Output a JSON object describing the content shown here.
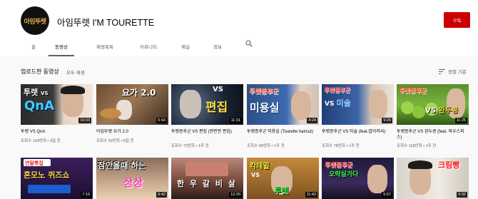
{
  "channel": {
    "avatar_text": "아임뚜렛",
    "title": "아임뚜렛 I'M TOURETTE",
    "subscribe_label": "구독"
  },
  "tabs": [
    {
      "label": "홈"
    },
    {
      "label": "동영상"
    },
    {
      "label": "재생목록"
    },
    {
      "label": "커뮤니티"
    },
    {
      "label": "채널"
    },
    {
      "label": "정보"
    }
  ],
  "section": {
    "title": "업로드한 동영상",
    "play_all": "모두 재생",
    "sort_label": "정렬 기준"
  },
  "videos_row1": [
    {
      "thumb_text": "투렛 QnA",
      "duration": "16:03",
      "title": "투렛 VS QnA",
      "meta": "조회수 104만회 • 3일 전"
    },
    {
      "thumb_text": "요가 2.0",
      "duration": "5:43",
      "title": "아임뚜렛 요가 2.0",
      "meta": "조회수 50만회 • 6일 전"
    },
    {
      "thumb_text": "편집",
      "duration": "11:31",
      "title": "투렛증후군 VS 편집 (찐찐찐 편집)",
      "meta": "조회수 73만회 • 1주 전"
    },
    {
      "thumb_text": "미용실",
      "duration": "4:24",
      "title": "투렛증후군 미용실 (Tourette haircut)",
      "meta": "조회수 94만회 • 1주 전"
    },
    {
      "thumb_text": "투렛증후군 VS 미술",
      "duration": "9:29",
      "title": "투렛증후군 VS 미술 (feat.밥아저씨)",
      "meta": "조회수 78만회 • 1주 전"
    },
    {
      "thumb_text": "투렛증후군 VS 완두콩",
      "duration": "11:25",
      "title": "투렛증후군 VS 완두콩 (feat. 마우스피스)",
      "meta": "조회수 118만회 • 1주 전"
    }
  ],
  "videos_row2": [
    {
      "thumb_text": "혼모노 퀴즈쇼",
      "duration": "7:19"
    },
    {
      "thumb_text": "잠안올때 하는 상상",
      "duration": "6:42"
    },
    {
      "thumb_text": "한 우 갈 비 살",
      "duration": "12:20"
    },
    {
      "thumb_text": "칵테일 VS 투렛",
      "duration": "11:43"
    },
    {
      "thumb_text": "투렛증후군 오락실가다",
      "duration": "5:57"
    },
    {
      "thumb_text": "크림빵",
      "duration": "0:32"
    }
  ],
  "colors": {
    "subscribe": "#cc0000",
    "background": "#f9f9f9"
  }
}
